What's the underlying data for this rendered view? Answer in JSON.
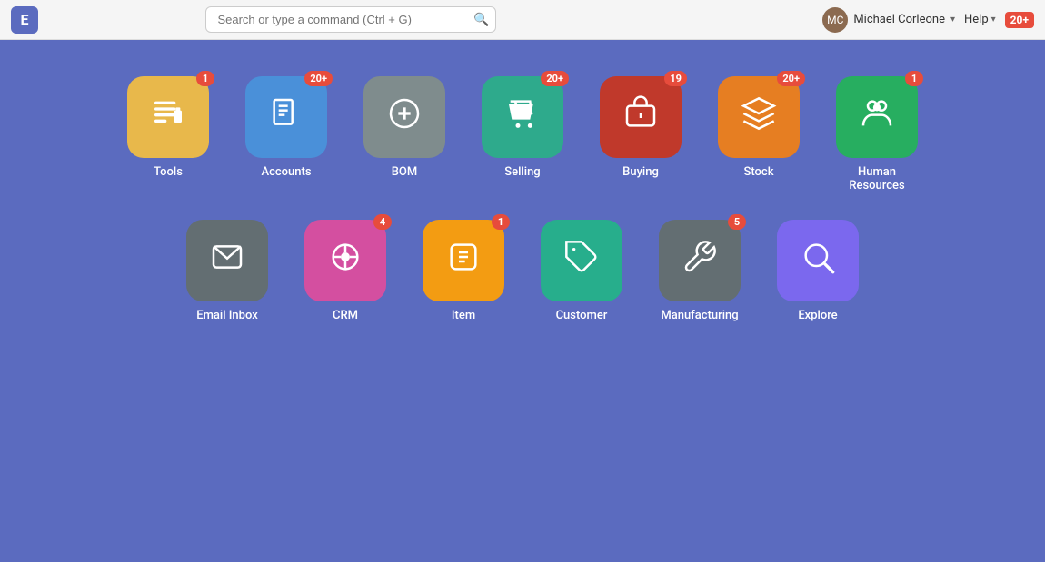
{
  "header": {
    "logo_letter": "E",
    "search_placeholder": "Search or type a command (Ctrl + G)",
    "user_name": "Michael Corleone",
    "help_label": "Help",
    "notification_count": "20+",
    "search_shortcut": "Ctrl + G"
  },
  "apps_row1": [
    {
      "id": "tools",
      "label": "Tools",
      "color": "color-yellow",
      "badge": "1",
      "icon": "tools"
    },
    {
      "id": "accounts",
      "label": "Accounts",
      "color": "color-blue",
      "badge": "20+",
      "icon": "accounts"
    },
    {
      "id": "bom",
      "label": "BOM",
      "color": "color-gray",
      "badge": null,
      "icon": "bom"
    },
    {
      "id": "selling",
      "label": "Selling",
      "color": "color-teal",
      "badge": "20+",
      "icon": "selling"
    },
    {
      "id": "buying",
      "label": "Buying",
      "color": "color-red",
      "badge": "19",
      "icon": "buying"
    },
    {
      "id": "stock",
      "label": "Stock",
      "color": "color-orange",
      "badge": "20+",
      "icon": "stock"
    },
    {
      "id": "hr",
      "label": "Human Resources",
      "color": "color-green",
      "badge": "1",
      "icon": "hr"
    }
  ],
  "apps_row2": [
    {
      "id": "email-inbox",
      "label": "Email Inbox",
      "color": "color-dark-gray",
      "badge": null,
      "icon": "email"
    },
    {
      "id": "crm",
      "label": "CRM",
      "color": "color-pink",
      "badge": "4",
      "icon": "crm"
    },
    {
      "id": "item",
      "label": "Item",
      "color": "color-amber",
      "badge": "1",
      "icon": "item"
    },
    {
      "id": "customer",
      "label": "Customer",
      "color": "color-teal2",
      "badge": null,
      "icon": "customer"
    },
    {
      "id": "manufacturing",
      "label": "Manufacturing",
      "color": "color-dark-gray",
      "badge": "5",
      "icon": "manufacturing"
    },
    {
      "id": "explore",
      "label": "Explore",
      "color": "color-purple",
      "badge": null,
      "icon": "explore"
    }
  ]
}
